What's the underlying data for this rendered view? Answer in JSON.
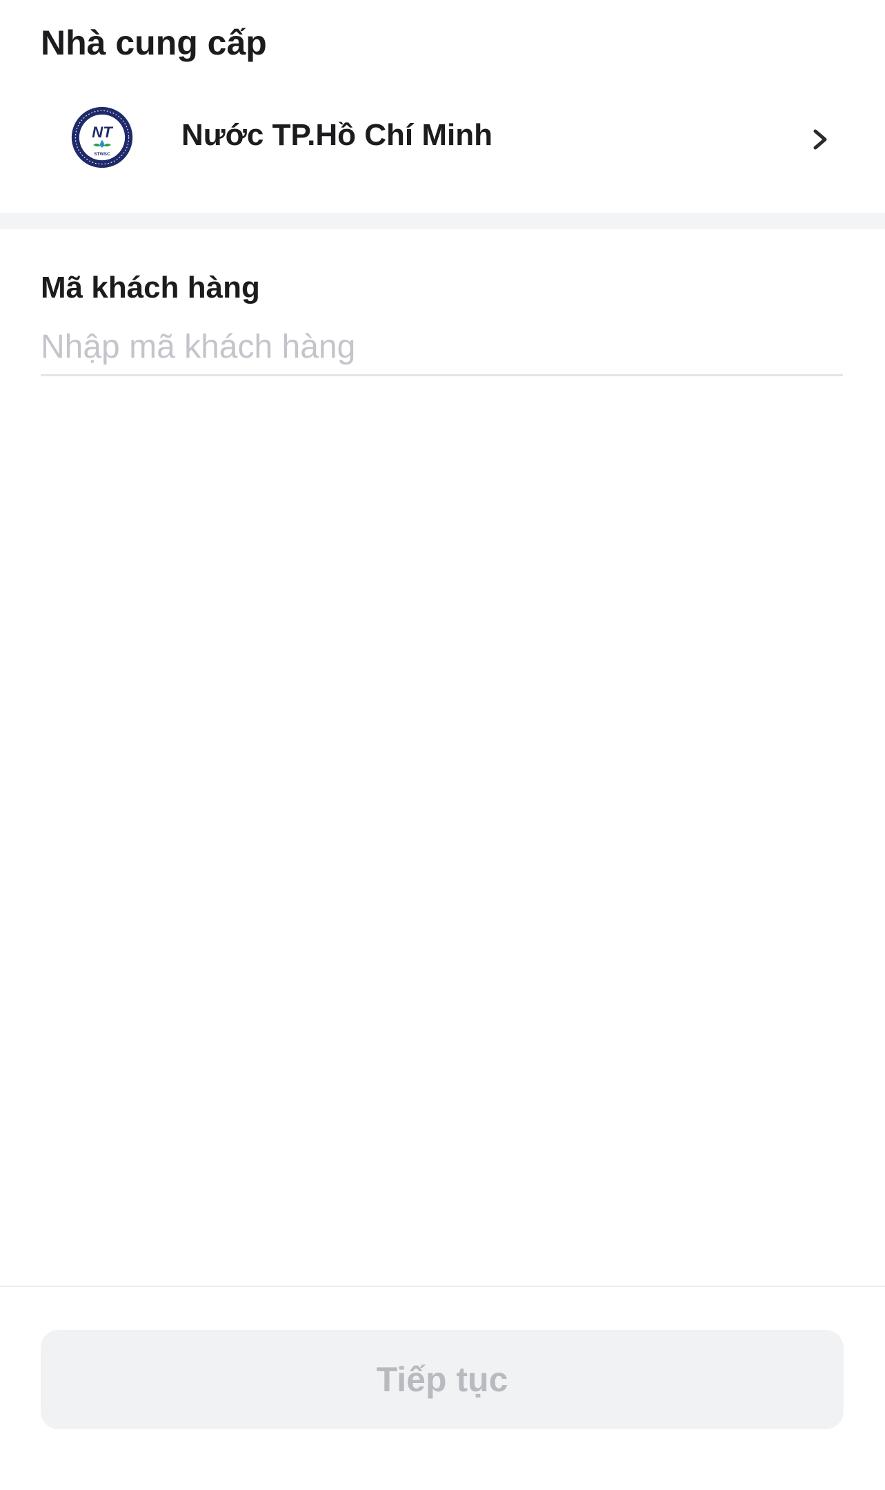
{
  "provider_section": {
    "title": "Nhà cung cấp",
    "provider_name": "Nước TP.Hồ Chí Minh",
    "logo_icon": "water-company-logo",
    "logo_text": "NT",
    "logo_subtext": "STWSC",
    "chevron_icon": "chevron-right-icon"
  },
  "customer_field": {
    "label": "Mã khách hàng",
    "placeholder": "Nhập mã khách hàng",
    "value": ""
  },
  "footer": {
    "continue_label": "Tiếp tục",
    "enabled": false
  },
  "colors": {
    "text_primary": "#1c1c1e",
    "placeholder": "#c3c5cb",
    "divider_band": "#f3f4f6",
    "button_disabled_bg": "#f1f2f4",
    "button_disabled_text": "#b8babf",
    "logo_navy": "#1f2a6b"
  }
}
